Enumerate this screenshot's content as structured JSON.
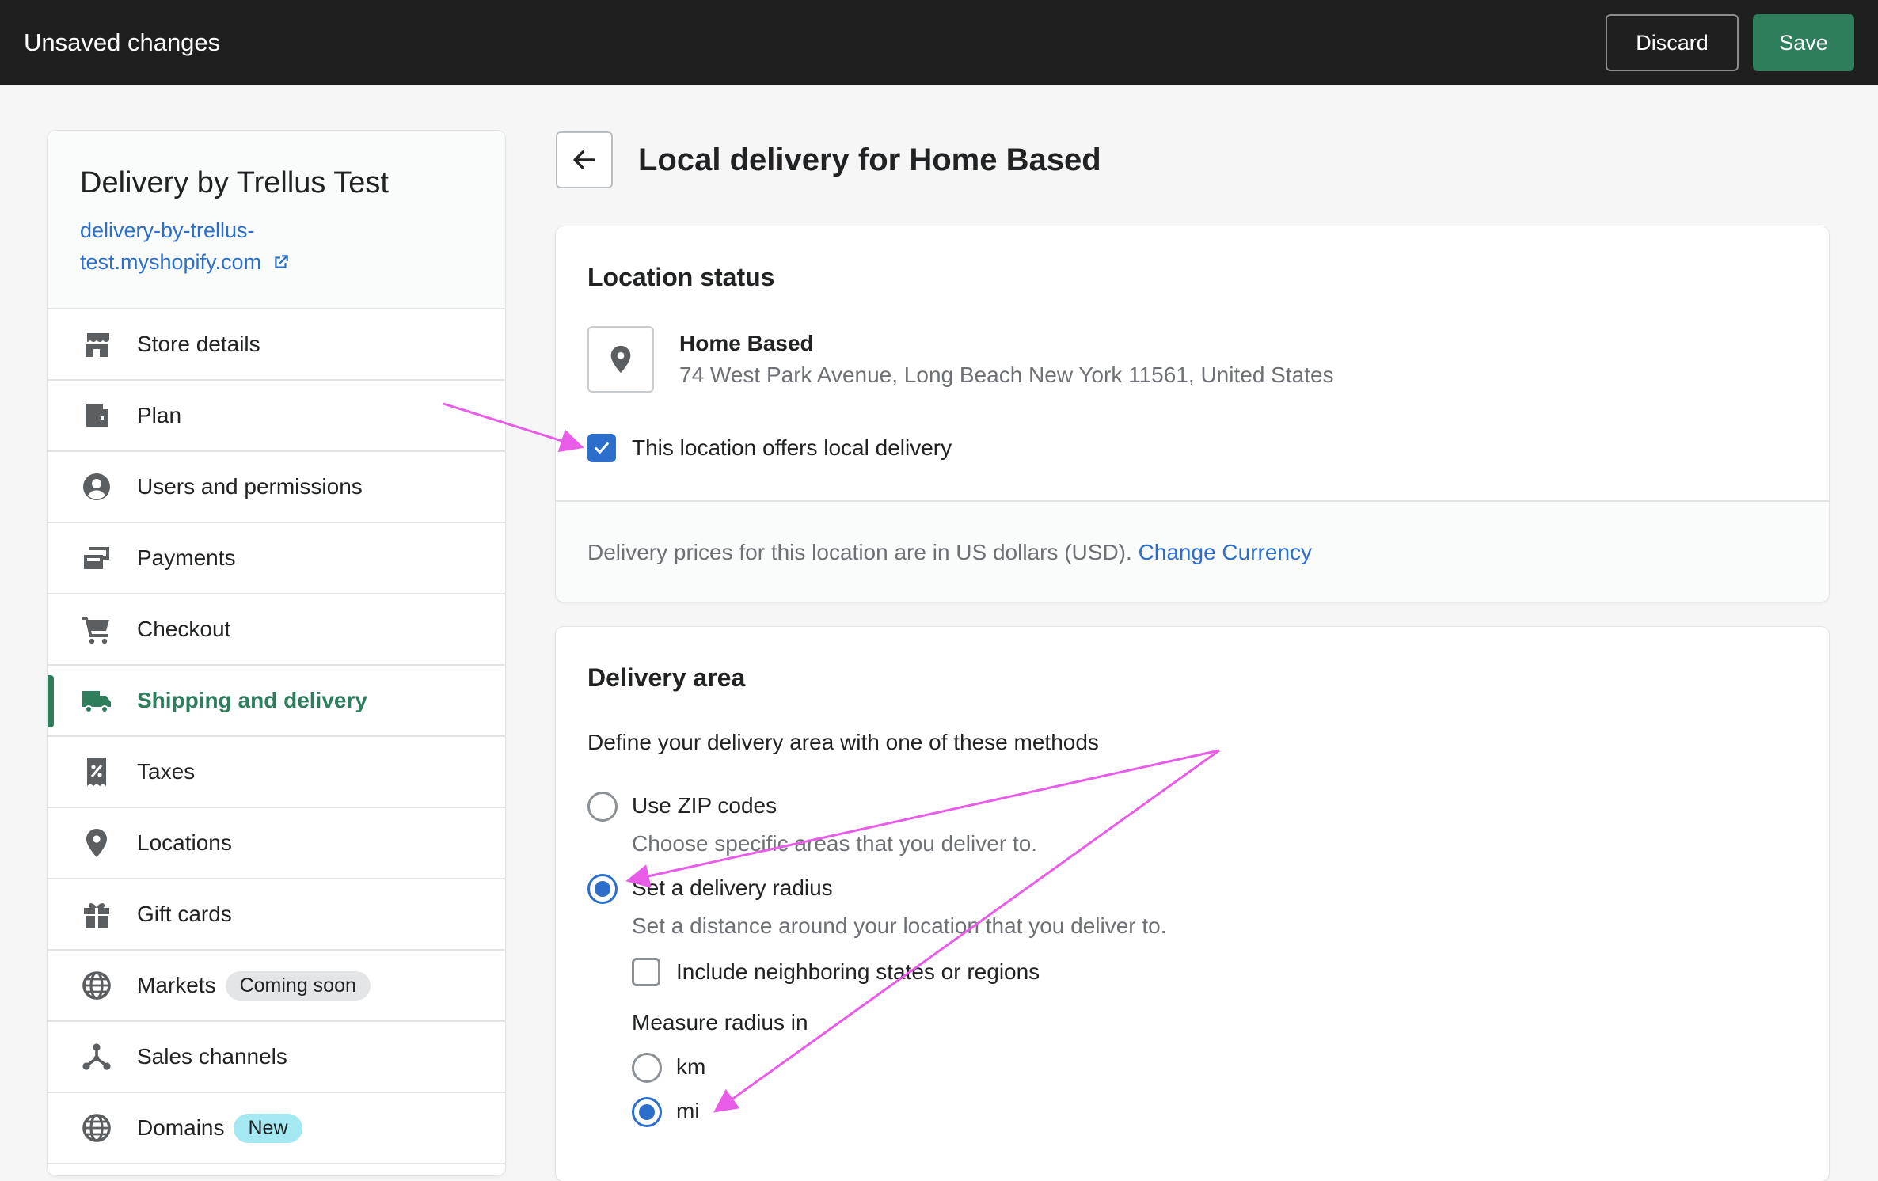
{
  "topbar": {
    "title": "Unsaved changes",
    "discard_label": "Discard",
    "save_label": "Save"
  },
  "sidebar": {
    "store_name": "Delivery by Trellus Test",
    "store_url_line1": "delivery-by-trellus-",
    "store_url_line2": "test.myshopify.com",
    "items": [
      {
        "label": "Store details",
        "icon": "store-icon"
      },
      {
        "label": "Plan",
        "icon": "wallet-icon"
      },
      {
        "label": "Users and permissions",
        "icon": "user-icon"
      },
      {
        "label": "Payments",
        "icon": "payments-icon"
      },
      {
        "label": "Checkout",
        "icon": "cart-icon"
      },
      {
        "label": "Shipping and delivery",
        "icon": "truck-icon",
        "active": true
      },
      {
        "label": "Taxes",
        "icon": "tax-receipt-icon"
      },
      {
        "label": "Locations",
        "icon": "location-pin-icon"
      },
      {
        "label": "Gift cards",
        "icon": "gift-icon"
      },
      {
        "label": "Markets",
        "icon": "globe-icon",
        "badge": "Coming soon"
      },
      {
        "label": "Sales channels",
        "icon": "sales-channels-icon"
      },
      {
        "label": "Domains",
        "icon": "domains-globe-icon",
        "badge": "New"
      }
    ]
  },
  "main": {
    "page_title": "Local delivery for Home Based",
    "location_status": {
      "title": "Location status",
      "location_name": "Home Based",
      "location_address": "74 West Park Avenue, Long Beach New York 11561, United States",
      "offers_local_delivery_label": "This location offers local delivery",
      "offers_local_delivery_checked": true,
      "price_note": "Delivery prices for this location are in US dollars (USD).",
      "change_currency_label": "Change Currency"
    },
    "delivery_area": {
      "title": "Delivery area",
      "intro": "Define your delivery area with one of these methods",
      "options": [
        {
          "label": "Use ZIP codes",
          "description": "Choose specific areas that you deliver to.",
          "selected": false
        },
        {
          "label": "Set a delivery radius",
          "description": "Set a distance around your location that you deliver to.",
          "selected": true
        }
      ],
      "include_neighboring_label": "Include neighboring states or regions",
      "include_neighboring_checked": false,
      "measure_label": "Measure radius in",
      "units": [
        {
          "label": "km",
          "selected": false
        },
        {
          "label": "mi",
          "selected": true
        }
      ]
    }
  },
  "colors": {
    "accent_green": "#2e7d5b",
    "link_blue": "#2c6ecb",
    "annotation_magenta": "#e85ce8",
    "topbar_bg": "#1f1f1f"
  }
}
